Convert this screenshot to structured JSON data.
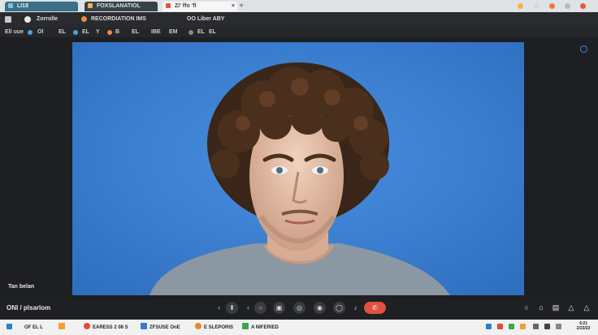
{
  "browser": {
    "tabs": [
      {
        "label": "LI18",
        "color": "#5aa9c9"
      },
      {
        "label": "FOXSLANATIOL",
        "color": "#f0b545"
      },
      {
        "label": "Zi' ffo 'fl",
        "color": "#e05a3f"
      }
    ],
    "new_tab_glyph": "+",
    "close_glyph": "×"
  },
  "toolbar": {
    "items": [
      "Zorrolle",
      "RECORDIATION IMS",
      "OO Liber ABY"
    ]
  },
  "meeting_header": {
    "items": [
      "Ell uue",
      "Ol",
      "EL",
      "EL",
      "Y",
      "B",
      "EL",
      "IBE",
      "EM",
      "EL",
      "EL",
      "EL",
      "EL",
      "EL",
      "EL"
    ]
  },
  "participant": {
    "self_label": "Tan belan",
    "meeting_label": "ONI / plsarlom"
  },
  "controls": {
    "end_call_glyph": "✆"
  },
  "taskbar": {
    "items": [
      "OF EL L",
      "EARESS 2 08 S",
      "ZFSUSE OnE",
      "E SLEPORIS",
      "A NIFERIED"
    ],
    "clock": {
      "time": "4:21",
      "date": "2/23/22"
    }
  },
  "icons": [
    "close-icon",
    "plus-icon",
    "mic-icon",
    "camera-icon",
    "screen-share-icon",
    "end-call-icon",
    "settings-icon",
    "warning-icon",
    "chat-icon"
  ]
}
